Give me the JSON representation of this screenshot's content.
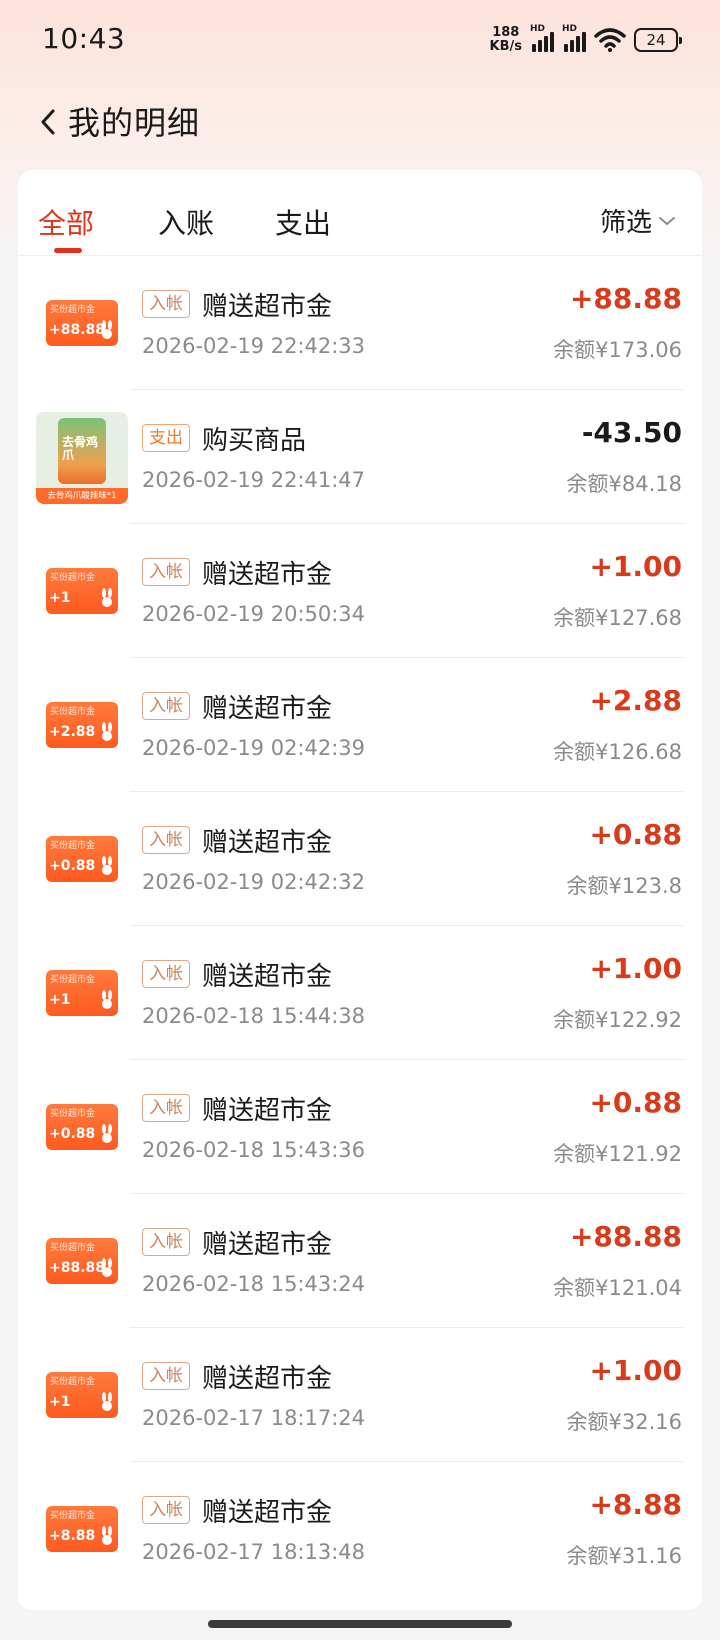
{
  "status_bar": {
    "time": "10:43",
    "net_speed_value": "188",
    "net_speed_unit": "KB/s",
    "hd_label": "HD",
    "battery": "24"
  },
  "header": {
    "title": "我的明细"
  },
  "tabs": [
    {
      "label": "全部",
      "active": true
    },
    {
      "label": "入账",
      "active": false
    },
    {
      "label": "支出",
      "active": false
    }
  ],
  "filter": {
    "label": "筛选"
  },
  "badge_caption": "买份超市金",
  "product_caption": "去骨鸡爪酸辣味*1",
  "product_can_text": "去骨鸡爪",
  "colors": {
    "accent": "#e2331a",
    "amount_positive": "#d93a1a",
    "thumb_orange": "#fe5a1f"
  },
  "transactions": [
    {
      "type": "income",
      "tag": "入帐",
      "title": "赠送超市金",
      "time": "2026-02-19 22:42:33",
      "amount": "+88.88",
      "balance": "余额¥173.06",
      "thumb_amount": "+88.88"
    },
    {
      "type": "expense",
      "tag": "支出",
      "title": "购买商品",
      "time": "2026-02-19 22:41:47",
      "amount": "-43.50",
      "balance": "余额¥84.18",
      "thumb_amount": ""
    },
    {
      "type": "income",
      "tag": "入帐",
      "title": "赠送超市金",
      "time": "2026-02-19 20:50:34",
      "amount": "+1.00",
      "balance": "余额¥127.68",
      "thumb_amount": "+1"
    },
    {
      "type": "income",
      "tag": "入帐",
      "title": "赠送超市金",
      "time": "2026-02-19 02:42:39",
      "amount": "+2.88",
      "balance": "余额¥126.68",
      "thumb_amount": "+2.88"
    },
    {
      "type": "income",
      "tag": "入帐",
      "title": "赠送超市金",
      "time": "2026-02-19 02:42:32",
      "amount": "+0.88",
      "balance": "余额¥123.8",
      "thumb_amount": "+0.88"
    },
    {
      "type": "income",
      "tag": "入帐",
      "title": "赠送超市金",
      "time": "2026-02-18 15:44:38",
      "amount": "+1.00",
      "balance": "余额¥122.92",
      "thumb_amount": "+1"
    },
    {
      "type": "income",
      "tag": "入帐",
      "title": "赠送超市金",
      "time": "2026-02-18 15:43:36",
      "amount": "+0.88",
      "balance": "余额¥121.92",
      "thumb_amount": "+0.88"
    },
    {
      "type": "income",
      "tag": "入帐",
      "title": "赠送超市金",
      "time": "2026-02-18 15:43:24",
      "amount": "+88.88",
      "balance": "余额¥121.04",
      "thumb_amount": "+88.88"
    },
    {
      "type": "income",
      "tag": "入帐",
      "title": "赠送超市金",
      "time": "2026-02-17 18:17:24",
      "amount": "+1.00",
      "balance": "余额¥32.16",
      "thumb_amount": "+1"
    },
    {
      "type": "income",
      "tag": "入帐",
      "title": "赠送超市金",
      "time": "2026-02-17 18:13:48",
      "amount": "+8.88",
      "balance": "余额¥31.16",
      "thumb_amount": "+8.88"
    }
  ]
}
